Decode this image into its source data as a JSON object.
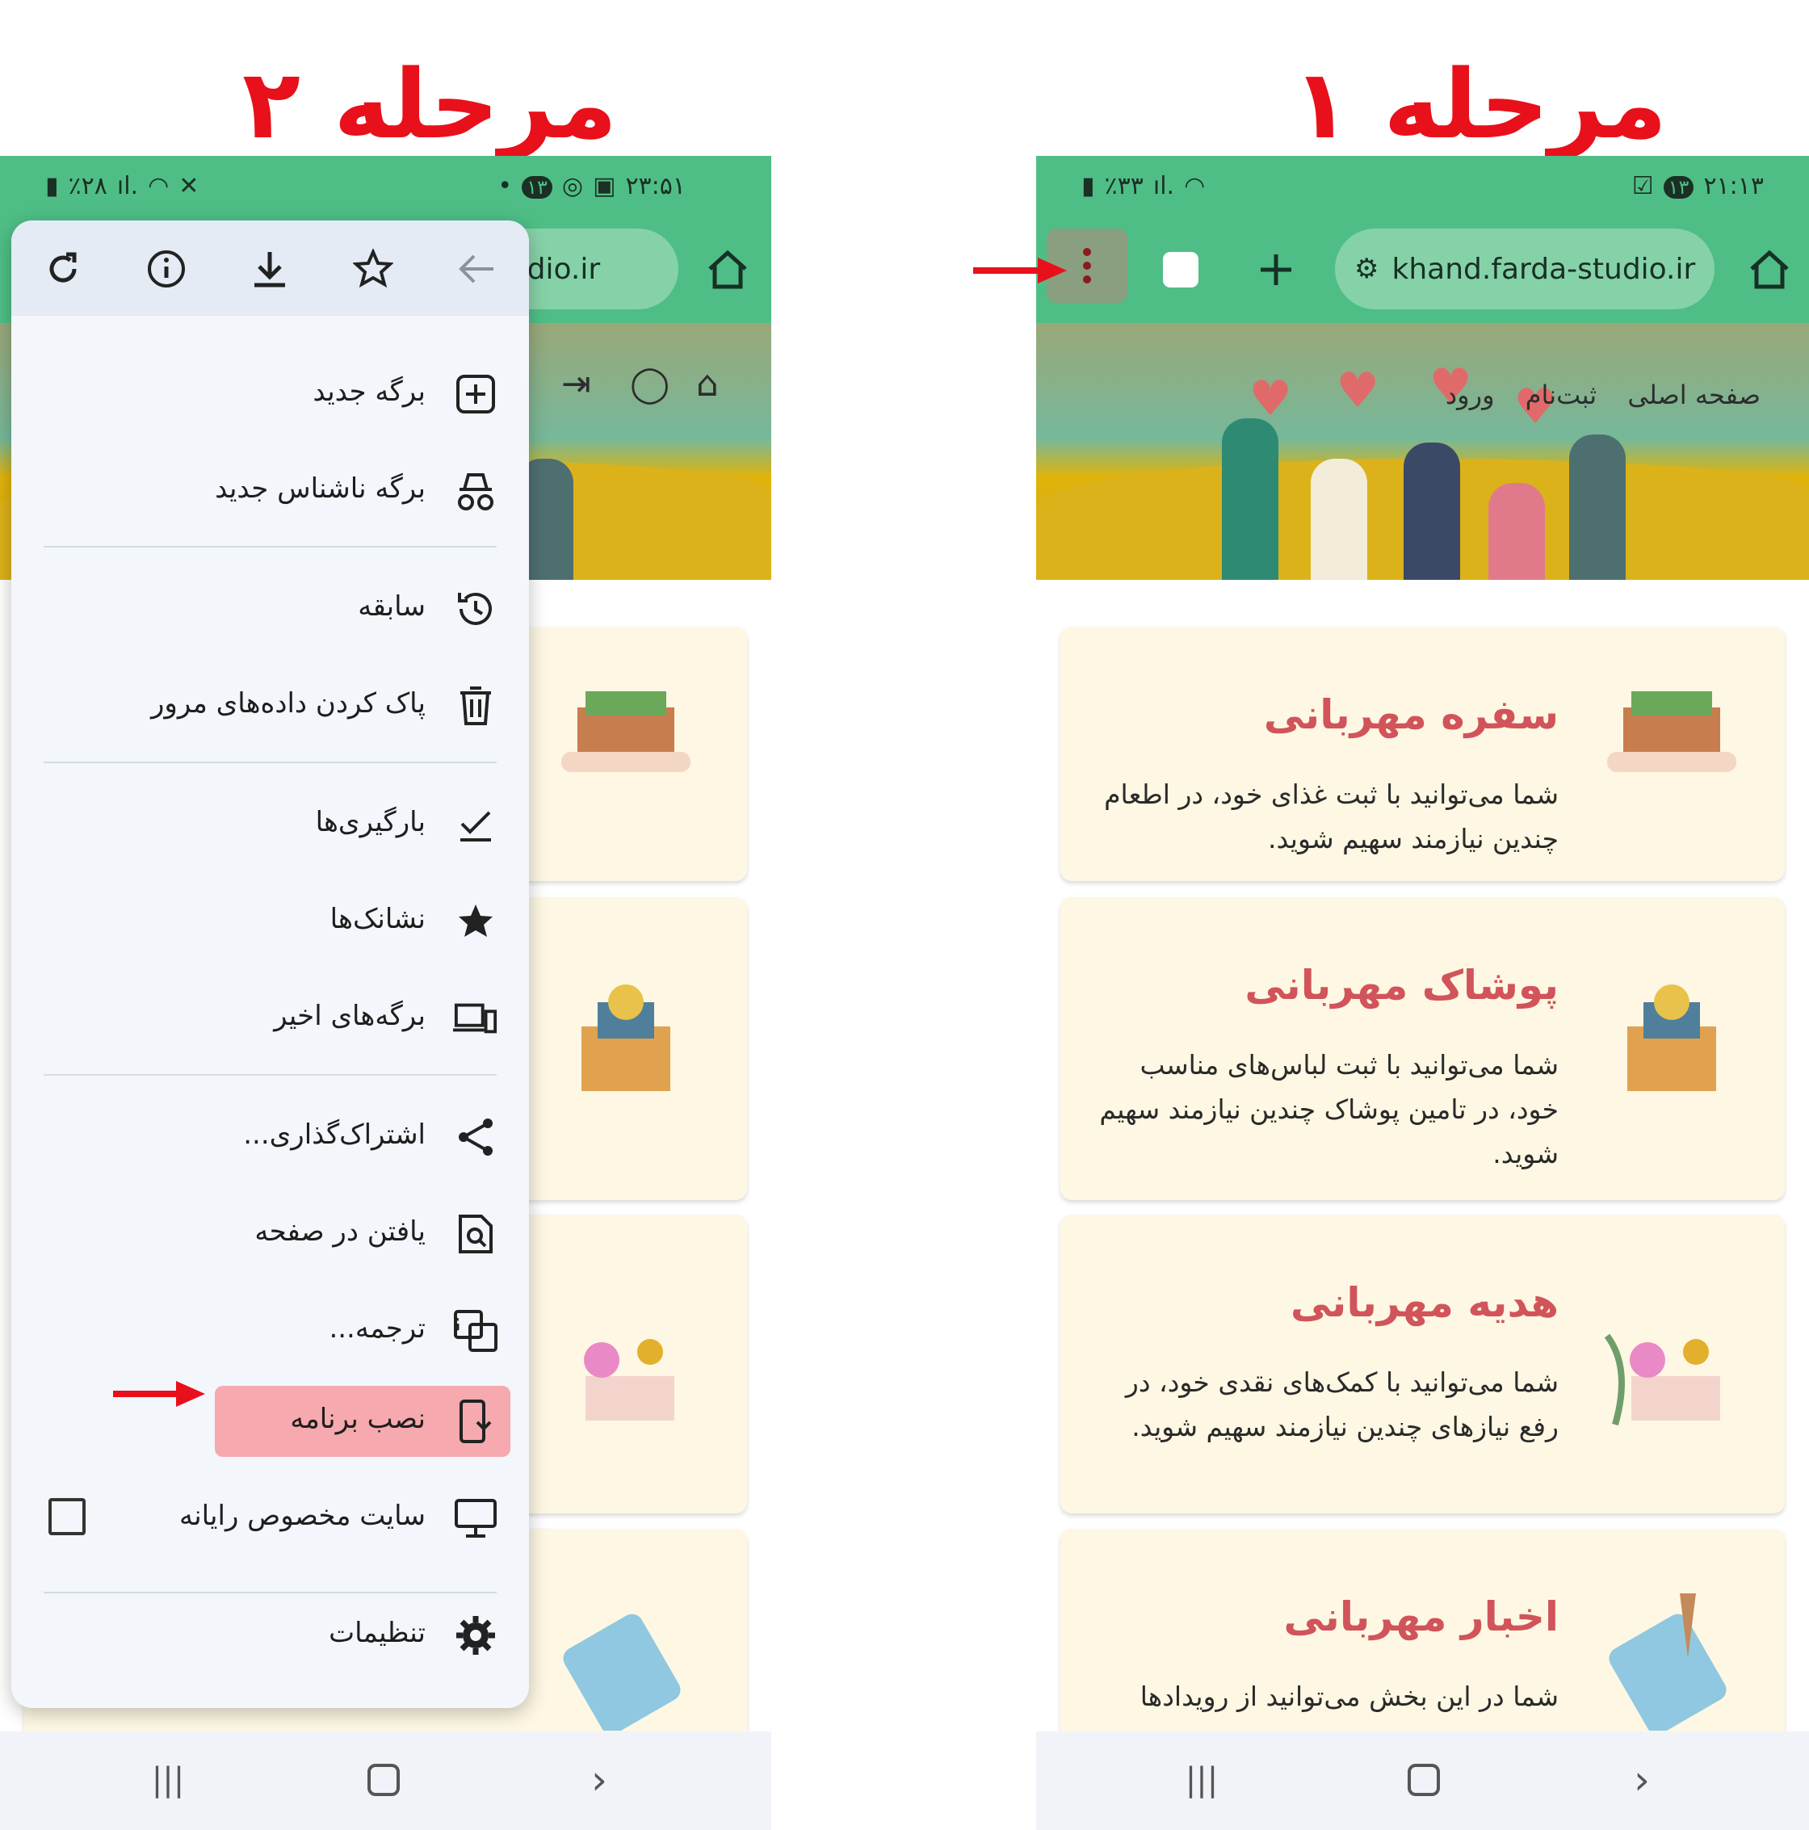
{
  "step_titles": {
    "step1": "مرحله ۱",
    "step2": "مرحله ۲"
  },
  "right_phone": {
    "status": {
      "time": "۲۱:۱۳",
      "sim": "۱۳",
      "battery": "٪۳۳"
    },
    "url": "khand.farda-studio.ir",
    "nav": {
      "home": "صفحه اصلی",
      "register": "ثبت‌نام",
      "login": "ورود"
    },
    "cards": [
      {
        "title": "سفره مهربانی",
        "desc": "شما می‌توانید با ثبت غذای خود، در اطعام چندین نیازمند سهیم شوید."
      },
      {
        "title": "پوشاک مهربانی",
        "desc": "شما می‌توانید با ثبت لباس‌های مناسب خود، در تامین پوشاک چندین نیازمند سهیم شوید."
      },
      {
        "title": "هدیه مهربانی",
        "desc": "شما می‌توانید با کمک‌های نقدی خود، در رفع نیازهای چندین نیازمند سهیم شوید."
      },
      {
        "title": "اخبار مهربانی",
        "desc": "شما در این بخش می‌توانید از رویدادها"
      }
    ]
  },
  "left_phone": {
    "status": {
      "time": "۲۳:۵۱",
      "sim": "۱۳",
      "battery": "٪۲۸"
    },
    "url_partial": "-studio.ir",
    "menu": {
      "items": [
        {
          "label": "برگه جدید",
          "icon": "plus-box-icon"
        },
        {
          "label": "برگه ناشناس جدید",
          "icon": "incognito-icon"
        },
        {
          "label": "سابقه",
          "icon": "history-icon"
        },
        {
          "label": "پاک کردن داده‌های مرور",
          "icon": "trash-icon"
        },
        {
          "label": "بارگیری‌ها",
          "icon": "download-check-icon"
        },
        {
          "label": "نشانک‌ها",
          "icon": "star-filled-icon"
        },
        {
          "label": "برگه‌های اخیر",
          "icon": "devices-icon"
        },
        {
          "label": "اشتراک‌گذاری...",
          "icon": "share-icon"
        },
        {
          "label": "یافتن در صفحه",
          "icon": "find-in-page-icon"
        },
        {
          "label": "ترجمه...",
          "icon": "translate-icon"
        },
        {
          "label": "نصب برنامه",
          "icon": "install-app-icon"
        },
        {
          "label": "سایت مخصوص رایانه",
          "icon": "desktop-icon"
        },
        {
          "label": "تنظیمات",
          "icon": "settings-icon"
        }
      ]
    }
  },
  "colors": {
    "accent_green": "#4fbe86",
    "highlight_pink": "#f6a9ae",
    "title_red": "#e8101a",
    "card_title": "#d1545a"
  }
}
